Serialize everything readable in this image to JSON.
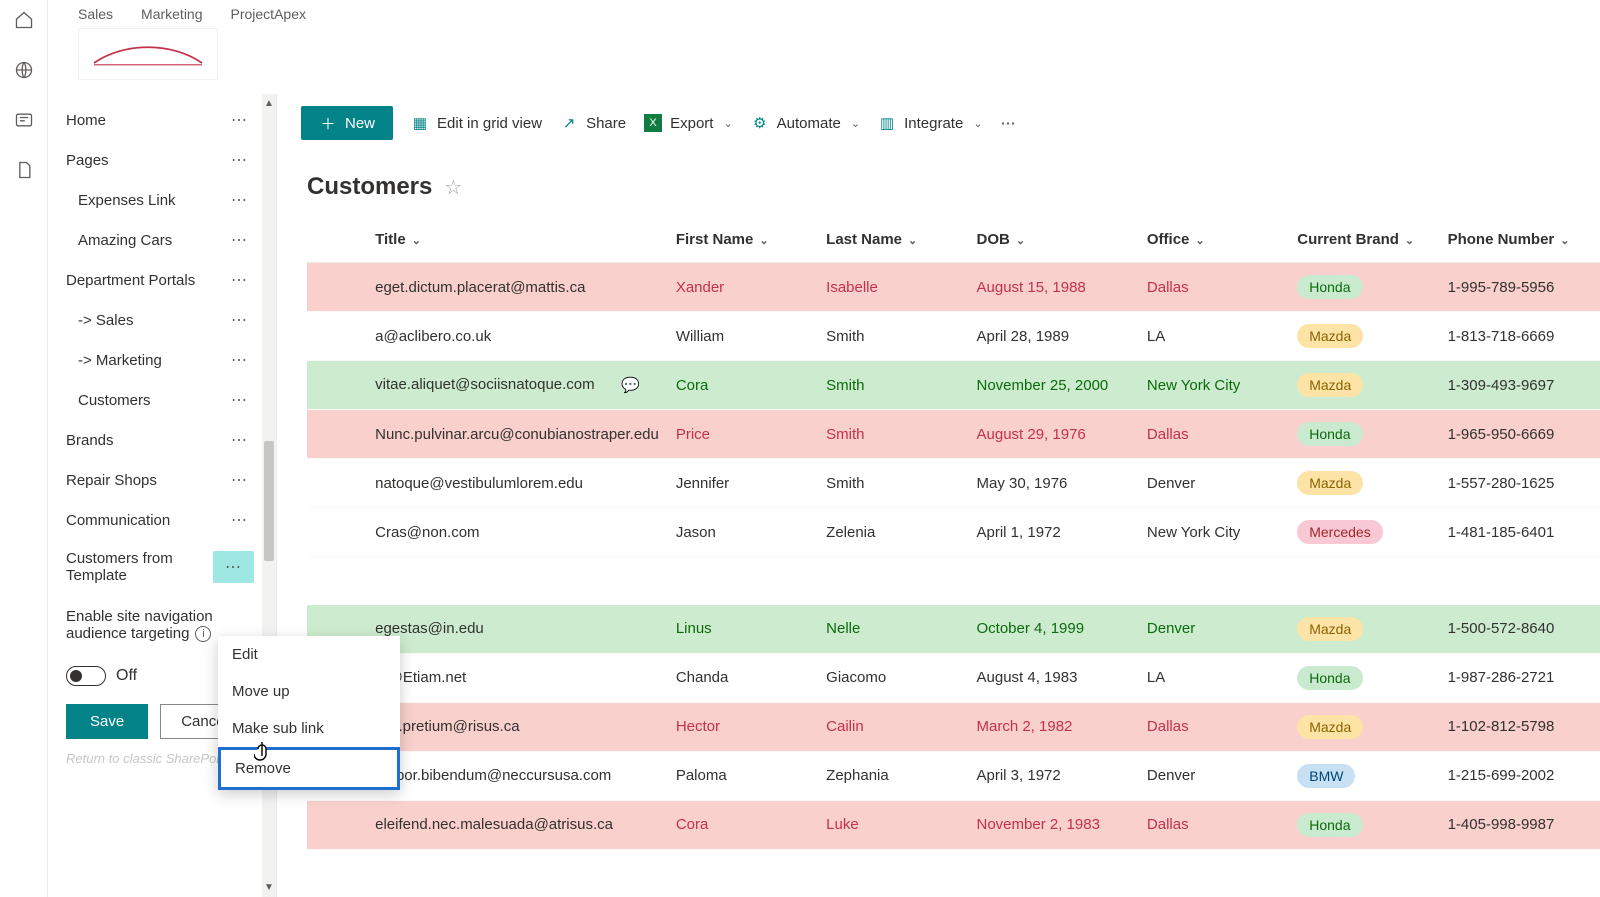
{
  "topTabs": {
    "t1": "Sales",
    "t2": "Marketing",
    "t3": "ProjectApex"
  },
  "nav": {
    "home": "Home",
    "pages": "Pages",
    "expenses": "Expenses Link",
    "amazing": "Amazing Cars",
    "dept": "Department Portals",
    "sales": "-> Sales",
    "marketing": "-> Marketing",
    "customers": "Customers",
    "brands": "Brands",
    "repair": "Repair Shops",
    "comm": "Communication",
    "cft": "Customers from Template"
  },
  "audience": {
    "line1": "Enable site navigation",
    "line2": "audience targeting",
    "toggleLabel": "Off",
    "save": "Save",
    "cancel": "Cancel",
    "return": "Return to classic SharePoint"
  },
  "ctx": {
    "edit": "Edit",
    "moveup": "Move up",
    "sublink": "Make sub link",
    "remove": "Remove"
  },
  "cmdbar": {
    "new": "New",
    "editGrid": "Edit in grid view",
    "share": "Share",
    "export": "Export",
    "automate": "Automate",
    "integrate": "Integrate"
  },
  "listTitle": "Customers",
  "columns": {
    "title": "Title",
    "first": "First Name",
    "last": "Last Name",
    "dob": "DOB",
    "office": "Office",
    "brand": "Current Brand",
    "phone": "Phone Number"
  },
  "rows": [
    {
      "style": "red",
      "title": "eget.dictum.placerat@mattis.ca",
      "first": "Xander",
      "last": "Isabelle",
      "dob": "August 15, 1988",
      "office": "Dallas",
      "brand": "Honda",
      "brandClass": "honda",
      "phone": "1-995-789-5956"
    },
    {
      "style": "plain",
      "title": "a@aclibero.co.uk",
      "first": "William",
      "last": "Smith",
      "dob": "April 28, 1989",
      "office": "LA",
      "brand": "Mazda",
      "brandClass": "mazda",
      "phone": "1-813-718-6669"
    },
    {
      "style": "green",
      "title": "vitae.aliquet@sociisnatoque.com",
      "first": "Cora",
      "last": "Smith",
      "dob": "November 25, 2000",
      "office": "New York City",
      "brand": "Mazda",
      "brandClass": "mazda",
      "phone": "1-309-493-9697",
      "comment": true
    },
    {
      "style": "red",
      "title": "Nunc.pulvinar.arcu@conubianostraper.edu",
      "first": "Price",
      "last": "Smith",
      "dob": "August 29, 1976",
      "office": "Dallas",
      "brand": "Honda",
      "brandClass": "honda",
      "phone": "1-965-950-6669"
    },
    {
      "style": "plain",
      "title": "natoque@vestibulumlorem.edu",
      "first": "Jennifer",
      "last": "Smith",
      "dob": "May 30, 1976",
      "office": "Denver",
      "brand": "Mazda",
      "brandClass": "mazda",
      "phone": "1-557-280-1625"
    },
    {
      "style": "plain",
      "title": "Cras@non.com",
      "first": "Jason",
      "last": "Zelenia",
      "dob": "April 1, 1972",
      "office": "New York City",
      "brand": "Mercedes",
      "brandClass": "mercedes",
      "phone": "1-481-185-6401"
    },
    {
      "spacer": true
    },
    {
      "style": "green",
      "title": "egestas@in.edu",
      "first": "Linus",
      "last": "Nelle",
      "dob": "October 4, 1999",
      "office": "Denver",
      "brand": "Mazda",
      "brandClass": "mazda",
      "phone": "1-500-572-8640"
    },
    {
      "style": "plain",
      "title": "m@Etiam.net",
      "first": "Chanda",
      "last": "Giacomo",
      "dob": "August 4, 1983",
      "office": "LA",
      "brand": "Honda",
      "brandClass": "honda",
      "phone": "1-987-286-2721"
    },
    {
      "style": "red",
      "title": ".elit.pretium@risus.ca",
      "first": "Hector",
      "last": "Cailin",
      "dob": "March 2, 1982",
      "office": "Dallas",
      "brand": "Mazda",
      "brandClass": "mazda",
      "phone": "1-102-812-5798"
    },
    {
      "style": "plain",
      "title": "empor.bibendum@neccursusa.com",
      "first": "Paloma",
      "last": "Zephania",
      "dob": "April 3, 1972",
      "office": "Denver",
      "brand": "BMW",
      "brandClass": "bmw",
      "phone": "1-215-699-2002"
    },
    {
      "style": "red",
      "title": "eleifend.nec.malesuada@atrisus.ca",
      "first": "Cora",
      "last": "Luke",
      "dob": "November 2, 1983",
      "office": "Dallas",
      "brand": "Honda",
      "brandClass": "honda",
      "phone": "1-405-998-9987"
    }
  ]
}
